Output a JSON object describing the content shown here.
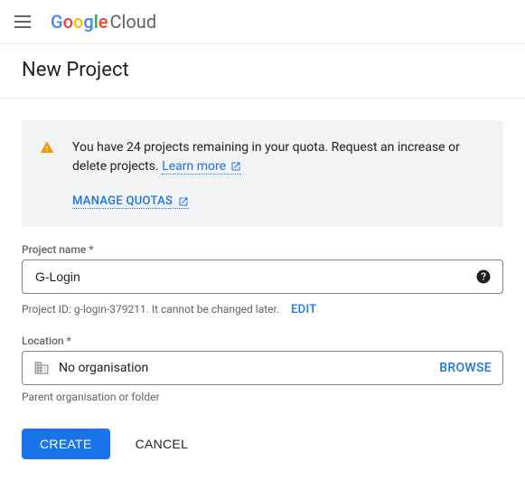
{
  "header": {
    "logo_google": "Google",
    "logo_cloud": "Cloud"
  },
  "page_title": "New Project",
  "notice": {
    "text": "You have 24 projects remaining in your quota. Request an increase or delete projects.",
    "learn_more_label": "Learn more",
    "manage_quotas_label": "MANAGE QUOTAS"
  },
  "form": {
    "project_name": {
      "label": "Project name *",
      "value": "G-Login"
    },
    "project_id": {
      "prefix": "Project ID: ",
      "id_value": "g-login-379211",
      "suffix": ". It cannot be changed later.",
      "edit_label": "EDIT"
    },
    "location": {
      "label": "Location *",
      "value": "No organisation",
      "browse_label": "BROWSE",
      "helper": "Parent organisation or folder"
    }
  },
  "buttons": {
    "create": "CREATE",
    "cancel": "CANCEL"
  },
  "colors": {
    "accent": "#1a73e8",
    "warning": "#f29900"
  }
}
